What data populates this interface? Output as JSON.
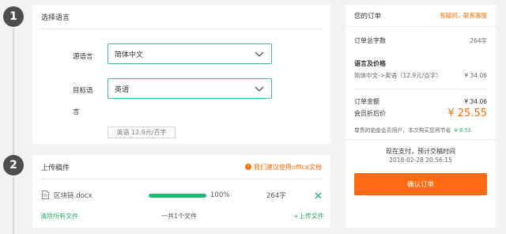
{
  "steps": {
    "step1": "1",
    "step2": "2"
  },
  "language_section": {
    "title": "选择语言",
    "source_label": "源语言",
    "source_value": "简体中文",
    "target_label_line1": "目标语",
    "target_label_line2": "言",
    "target_value": "英语",
    "rate_tag": "英语 12.9元/百字"
  },
  "upload_section": {
    "title": "上传稿件",
    "suggestion": "我们建议使用office文档",
    "file": {
      "name": "区块链.docx",
      "progress_pct": 100,
      "progress_text": "100%",
      "word_count": "264字"
    },
    "clear_all": "清除所有文件",
    "file_count": "一共1个文件",
    "upload_more": "+上传文件"
  },
  "order": {
    "title": "您的订单",
    "help_link": "有疑问，联系客服",
    "total_words_label": "订单总字数",
    "total_words_value": "264字",
    "lang_price_label": "语言及价格",
    "lang_price_desc": "简体中文->英语（12.9元/百字）",
    "lang_price_value": "¥ 34.06",
    "amount_label": "订单金额",
    "amount_value": "¥ 34.06",
    "member_price_label": "会员折后价",
    "member_price_value": "¥ 25.55",
    "member_note": "尊贵的铂金会员用户，本次购买您将节省",
    "member_saving": "¥ 8.51",
    "pay_now_line1": "现在支付，预计交稿时间",
    "pay_now_time": "2018-02-28 20:56:15",
    "confirm_button": "确认订单"
  },
  "colors": {
    "accent_green": "#3cbf8b",
    "progress_green": "#1fb872",
    "accent_orange": "#ff6a13"
  }
}
